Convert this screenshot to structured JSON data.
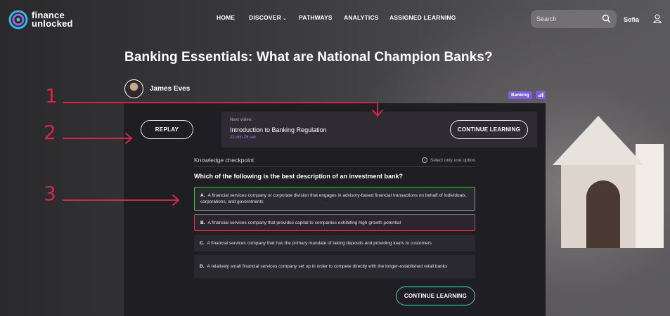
{
  "header": {
    "logo_line1": "finance",
    "logo_line2": "unlocked",
    "nav": [
      {
        "label": "HOME"
      },
      {
        "label": "DISCOVER",
        "has_dropdown": true
      },
      {
        "label": "PATHWAYS"
      },
      {
        "label": "ANALYTICS"
      },
      {
        "label": "ASSIGNED LEARNING"
      }
    ],
    "search_placeholder": "Search",
    "username": "Sofia",
    "icons": {
      "search": "search-icon",
      "user": "user-icon",
      "chevron": "chevron-down-icon"
    }
  },
  "page": {
    "title": "Banking Essentials: What are National Champion Banks?",
    "author": "James Eves",
    "tag": "Banking"
  },
  "player": {
    "replay_label": "REPLAY",
    "next_label": "Next video:",
    "next_title": "Introduction to Banking Regulation",
    "next_duration": "23 min 25 sec",
    "continue_label": "CONTINUE LEARNING"
  },
  "checkpoint": {
    "title": "Knowledge checkpoint",
    "hint": "Select only one option",
    "question": "Which of the following is the best description of an investment bank?",
    "options": [
      {
        "letter": "A.",
        "text": "A financial services company or corporate division that engages in advisory-based financial transactions on behalf of individuals, corporations, and governments",
        "state": "correct"
      },
      {
        "letter": "B.",
        "text": "A financial services company that provides capital to companies exhibiting high growth potential",
        "state": "incorrect"
      },
      {
        "letter": "C.",
        "text": "A financial services company that has the primary mandate of taking deposits and providing loans to customers",
        "state": "neutral"
      },
      {
        "letter": "D.",
        "text": "A relatively small financial services company set up in order to compete directly with the longer-established retail banks",
        "state": "neutral"
      }
    ],
    "continue_label": "CONTINUE LEARNING"
  },
  "annotations": [
    "1",
    "2",
    "3"
  ],
  "colors": {
    "accent_purple": "#7b5fd6",
    "correct_green": "#5fb05a",
    "incorrect_red": "#c2475c",
    "teal": "#57c9bf",
    "annotation_red": "#cc2a4a"
  }
}
